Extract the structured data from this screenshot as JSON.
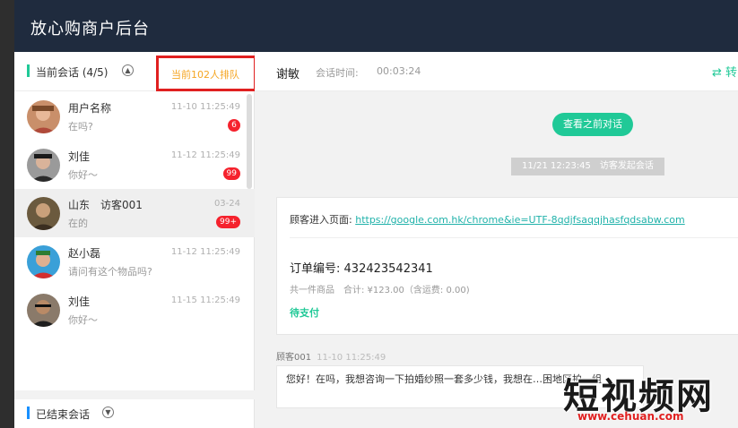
{
  "app": {
    "title": "放心购商户后台"
  },
  "sidebar": {
    "current_title": "当前会话 (4/5)",
    "queue_text": "当前102人排队",
    "ended_title": "已结束会话",
    "items": [
      {
        "name": "用户名称",
        "preview": "在吗?",
        "time": "11-10 11:25:49",
        "badge": "6"
      },
      {
        "name": "刘佳",
        "preview": "你好～",
        "time": "11-12 11:25:49",
        "badge": "99"
      },
      {
        "name": "山东　访客001",
        "preview": "在的",
        "time": "03-24",
        "badge": "99+"
      },
      {
        "name": "赵小磊",
        "preview": "请问有这个物品吗?",
        "time": "11-12 11:25:49",
        "badge": ""
      },
      {
        "name": "刘佳",
        "preview": "你好～",
        "time": "11-15 11:25:49",
        "badge": ""
      }
    ]
  },
  "chat": {
    "visitor_name": "谢敏",
    "session_label": "会话时间:",
    "session_time": "00:03:24",
    "transfer_label": "转",
    "view_prev_label": "查看之前对话",
    "system_time": "11/21 12:23:45　访客发起会话",
    "card": {
      "page_label": "顾客进入页面:",
      "page_url": "https://google.com.hk/chrome&ie=UTF-8qdjfsaqqjhasfqdsabw.com",
      "order_label": "订单编号:",
      "order_no": "432423542341",
      "summary": "共一件商品　合计: ¥123.00（含运费: 0.00)",
      "status": "待支付"
    },
    "message": {
      "sender": "顾客001",
      "time": "11-10 11:25:49",
      "text": "您好！在吗，我想咨询一下拍婚纱照一套多少钱，我想在…困地区拍一组"
    }
  },
  "watermark": {
    "big": "短视频网",
    "url": "www.cehuan.com"
  },
  "colors": {
    "header": "#1f2b3e",
    "accent": "#20c997",
    "badge": "#f5222d",
    "queue": "#f5a623",
    "highlight_box": "#e02020"
  }
}
